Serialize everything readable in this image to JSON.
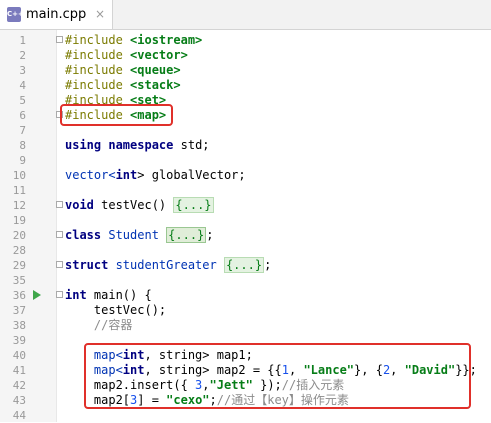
{
  "tab": {
    "label": "main.cpp",
    "icon": "cpp-file-icon",
    "icon_text": "C++",
    "close": "×"
  },
  "lines": [
    {
      "n": "1",
      "t": "#include <iostream>"
    },
    {
      "n": "2",
      "t": "#include <vector>"
    },
    {
      "n": "3",
      "t": "#include <queue>"
    },
    {
      "n": "4",
      "t": "#include <stack>"
    },
    {
      "n": "5",
      "t": "#include <set>"
    },
    {
      "n": "6",
      "t": "#include <map>"
    },
    {
      "n": "7",
      "t": ""
    },
    {
      "n": "8",
      "t": "using namespace std;"
    },
    {
      "n": "9",
      "t": ""
    },
    {
      "n": "10",
      "t": "vector<int> globalVector;"
    },
    {
      "n": "11",
      "t": ""
    },
    {
      "n": "12",
      "t": "void testVec() {...}"
    },
    {
      "n": "19",
      "t": ""
    },
    {
      "n": "20",
      "t": "class Student {...};"
    },
    {
      "n": "28",
      "t": ""
    },
    {
      "n": "29",
      "t": "struct studentGreater {...};"
    },
    {
      "n": "35",
      "t": ""
    },
    {
      "n": "36",
      "t": "int main() {"
    },
    {
      "n": "37",
      "t": "    testVec();"
    },
    {
      "n": "38",
      "t": "    //容器"
    },
    {
      "n": "39",
      "t": ""
    },
    {
      "n": "40",
      "t": "    map<int, string> map1;"
    },
    {
      "n": "41",
      "t": "    map<int, string> map2 = {{1, \"Lance\"}, {2, \"David\"}};"
    },
    {
      "n": "42",
      "t": "    map2.insert({ 3,\"Jett\" });//插入元素"
    },
    {
      "n": "43",
      "t": "    map2[3] = \"cexo\";//通过【key】操作元素"
    },
    {
      "n": "44",
      "t": ""
    }
  ],
  "code": {
    "inc_kw": "#include",
    "inc": [
      "<iostream>",
      "<vector>",
      "<queue>",
      "<stack>",
      "<set>",
      "<map>"
    ],
    "using": "using",
    "namespace": "namespace",
    "std": "std;",
    "vector": "vector<",
    "int": "int",
    "vector_close": "> globalVector;",
    "void": "void",
    "testVec": " testVec() ",
    "fold": "{...}",
    "class": "class",
    "student": " Student ",
    "semi": ";",
    "struct": "struct",
    "studentGreater": " studentGreater ",
    "main_sig": " main() {",
    "call": "    testVec();",
    "comment_container": "    //容器",
    "map1_pre": "    map<",
    "map1_post": ", string> map1;",
    "map2_pre": "    map<",
    "map2_mid": ", string> map2 = {{",
    "n1": "1",
    "comma": ", ",
    "lance": "\"Lance\"",
    "brace_mid": "}, {",
    "n2": "2",
    "david": "\"David\"",
    "brace_end": "}};",
    "insert_pre": "    map2.insert({ ",
    "n3": "3",
    "jett": "\"Jett\"",
    "insert_post": " });",
    "insert_cmt": "//插入元素",
    "assign_pre": "    map2[",
    "n3b": "3",
    "assign_mid": "] = ",
    "cexo": "\"cexo\"",
    "assign_semi": ";",
    "assign_cmt": "//通过【key】操作元素"
  },
  "colors": {
    "highlight_box": "#e0302a",
    "run_icon": "#3fa64a"
  }
}
